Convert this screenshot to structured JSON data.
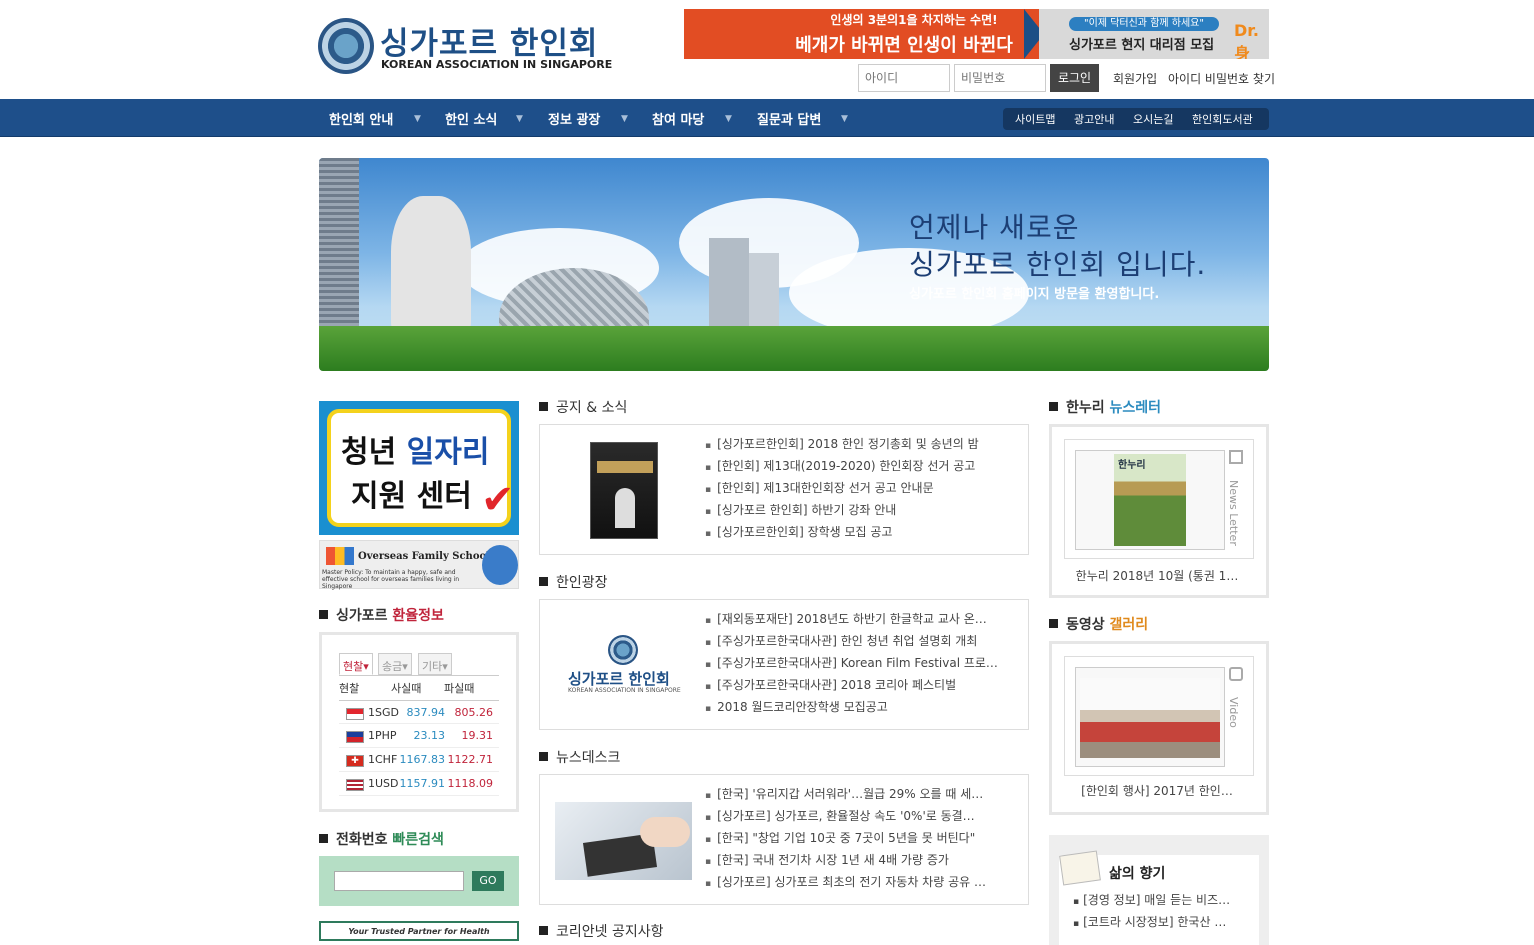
{
  "header": {
    "logo_title": "싱가포르 한인회",
    "logo_subtitle": "KOREAN ASSOCIATION IN SINGAPORE",
    "ad": {
      "line1": "인생의 3분의1을 차지하는 수면!",
      "line2": "베개가 바뀌면 인생이 바뀐다",
      "right_tag": "\"이제 닥터신과 함께 하세요\"",
      "right_main": "싱가포르 현지 대리점 모집",
      "brand": "Dr.身"
    },
    "login": {
      "id_placeholder": "아이디",
      "pw_placeholder": "비밀번호",
      "login_label": "로그인",
      "join_label": "회원가입",
      "find_label": "아이디 비밀번호 찾기"
    }
  },
  "nav": {
    "items": [
      "한인회 안내",
      "한인 소식",
      "정보 광장",
      "참여 마당",
      "질문과 답변"
    ],
    "quick": [
      "사이트맵",
      "광고안내",
      "오시는길",
      "한인회도서관"
    ]
  },
  "banner": {
    "line1": "언제나 새로운",
    "line2": "싱가포르 한인회 입니다.",
    "line3": "싱가포르 한인회 홈페이지 방문을 환영합니다."
  },
  "left": {
    "job_banner": {
      "line1a": "청년 ",
      "line1b": "일자리",
      "line2": "지원 센터",
      "check": "✔"
    },
    "ofs_banner": {
      "title": "Overseas Family School",
      "sub": "Master Policy: To maintain a happy, safe and effective school for overseas families living in Singapore"
    },
    "rate": {
      "title_prefix": "싱가포르 ",
      "title_hl": "환율정보",
      "tabs": [
        "현찰▾",
        "송금▾",
        "기타▾"
      ],
      "headers": [
        "현찰",
        "사실때",
        "파실때"
      ],
      "rows": [
        {
          "cur": "1SGD",
          "buy": "837.94",
          "sell": "805.26"
        },
        {
          "cur": "1PHP",
          "buy": "23.13",
          "sell": "19.31"
        },
        {
          "cur": "1CHF",
          "buy": "1167.83",
          "sell": "1122.71"
        },
        {
          "cur": "1USD",
          "buy": "1157.91",
          "sell": "1118.09"
        }
      ]
    },
    "phone": {
      "title_prefix": "전화번호 ",
      "title_hl": "빠른검색",
      "go_label": "GO"
    },
    "partner_banner": "Your Trusted Partner for Health"
  },
  "center": {
    "notice": {
      "title": "공지 & 소식",
      "items": [
        "[싱가포르한인회] 2018 한인 정기총회 및 송년의 밤",
        "[한인회] 제13대(2019-2020) 한인회장 선거 공고",
        "[한인회] 제13대한인회장 선거 공고 안내문",
        "[싱가포르 한인회] 하반기 강좌 안내",
        "[싱가포르한인회] 장학생 모집 공고"
      ]
    },
    "plaza": {
      "title": "한인광장",
      "logo_title": "싱가포르 한인회",
      "logo_sub": "KOREAN ASSOCIATION IN SINGAPORE",
      "items": [
        "[재외동포재단] 2018년도 하반기 한글학교 교사 온…",
        "[주싱가포르한국대사관] 한인 청년 취업 설명회 개최",
        "[주싱가포르한국대사관] Korean Film Festival 프로…",
        "[주싱가포르한국대사관] 2018 코리아 페스티벌",
        "2018 월드코리안장학생 모집공고"
      ]
    },
    "newsdesk": {
      "title": "뉴스데스크",
      "items": [
        "[한국] '유리지갑 서러워라'…월급 29% 오를 때 세…",
        "[싱가포르] 싱가포르, 환율절상 속도 '0%'로 동결…",
        "[한국] \"창업 기업 10곳 중 7곳이 5년을 못 버틴다\"",
        "[한국] 국내 전기차 시장 1년 새 4배 가량 증가",
        "[싱가포르] 싱가포르 최초의 전기 자동차 차량 공유 …"
      ]
    },
    "next_title": "코리안넷 공지사항"
  },
  "right": {
    "newsletter": {
      "title_prefix": "한누리 ",
      "title_hl": "뉴스레터",
      "vertical_label": "News Letter",
      "cover_text": "한누리",
      "caption": "한누리 2018년 10월 (통권 1…"
    },
    "video": {
      "title_prefix": "동영상 ",
      "title_hl": "갤러리",
      "vertical_label": "Video",
      "caption": "[한인회 행사] 2017년 한인…"
    },
    "life": {
      "title": "삶의 향기",
      "items": [
        "[경영 정보] 매일 듣는 비즈…",
        "[코트라 시장정보] 한국산 …"
      ]
    }
  },
  "colors": {
    "nav_bg": "#1e4f8a",
    "brand_blue": "#1e4f86",
    "rate_hl": "#c0243b",
    "phone_hl": "#2e8b57",
    "newsletter_hl": "#2b8bbf",
    "gallery_hl": "#e08a1c"
  }
}
